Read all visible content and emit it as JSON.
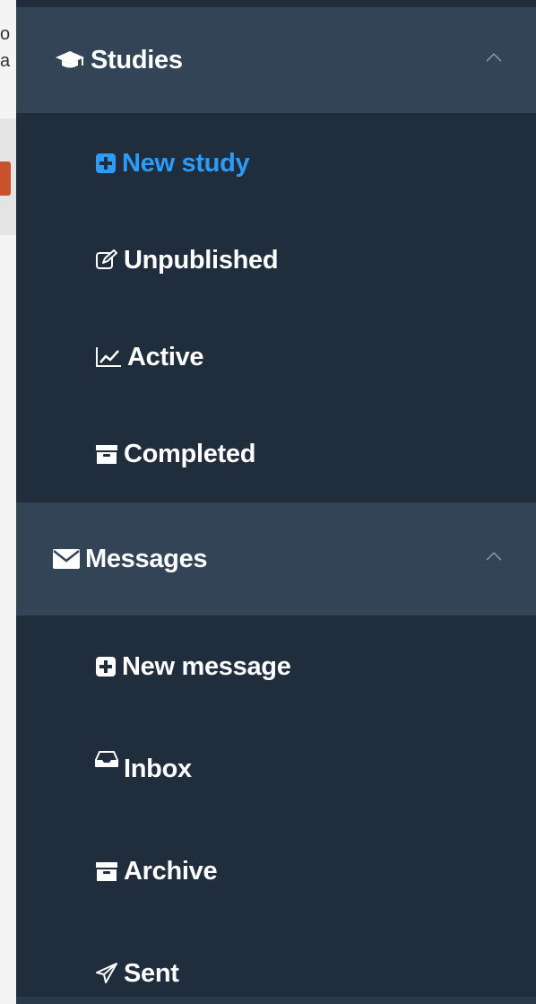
{
  "background_page": {
    "fragments": [
      "o",
      "a"
    ],
    "accent": "#c8522c"
  },
  "sidebar": {
    "colors": {
      "background": "#1f2d3d",
      "header": "#324456",
      "text": "#ffffff",
      "active": "#2d9cf7"
    },
    "sections": [
      {
        "title": "Studies",
        "icon": "graduation-cap-icon",
        "expanded": true,
        "items": [
          {
            "label": "New study",
            "icon": "plus-square-icon",
            "active": true
          },
          {
            "label": "Unpublished",
            "icon": "edit-icon",
            "active": false
          },
          {
            "label": "Active",
            "icon": "line-chart-icon",
            "active": false
          },
          {
            "label": "Completed",
            "icon": "archive-icon",
            "active": false
          }
        ]
      },
      {
        "title": "Messages",
        "icon": "envelope-icon",
        "expanded": true,
        "items": [
          {
            "label": "New message",
            "icon": "plus-square-icon",
            "active": false
          },
          {
            "label": "Inbox",
            "icon": "inbox-icon",
            "active": false
          },
          {
            "label": "Archive",
            "icon": "archive-icon",
            "active": false
          },
          {
            "label": "Sent",
            "icon": "paper-plane-icon",
            "active": false
          }
        ]
      }
    ]
  }
}
